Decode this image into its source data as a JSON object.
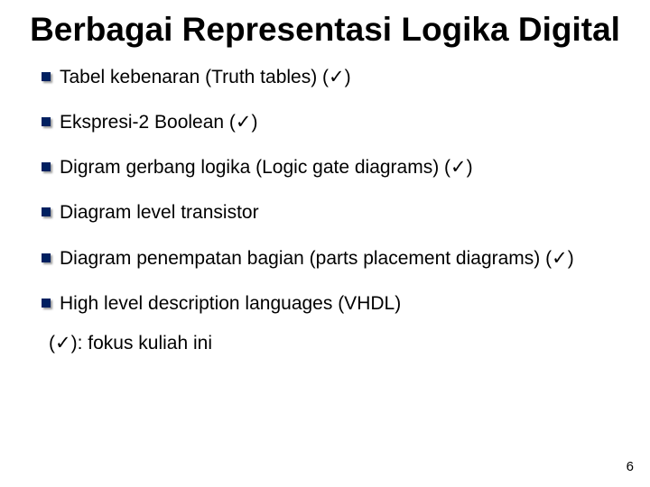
{
  "check_glyph": "✓",
  "title": "Berbagai Representasi Logika Digital",
  "items": [
    {
      "text": "Tabel kebenaran (Truth tables) (✓)"
    },
    {
      "text": "Ekspresi-2 Boolean (✓)"
    },
    {
      "text": "Digram gerbang logika (Logic gate diagrams) (✓)"
    },
    {
      "text": "Diagram level transistor"
    },
    {
      "text": "Diagram penempatan bagian (parts placement diagrams) (✓)"
    },
    {
      "text": "High level description languages (VHDL)"
    }
  ],
  "footnote": "(✓): fokus kuliah ini",
  "page_number": "6"
}
